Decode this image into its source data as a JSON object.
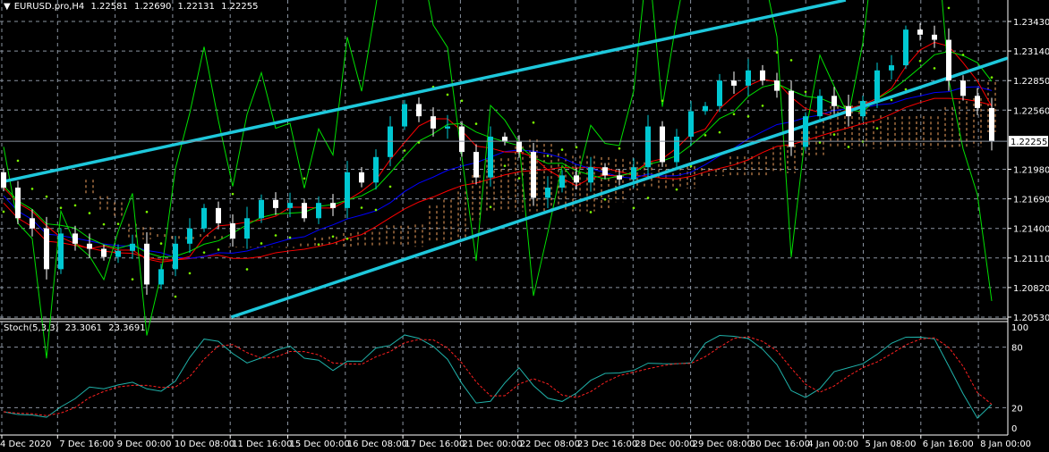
{
  "header": {
    "symbol": "EURUSD.pro,H4",
    "open": "1.22581",
    "high": "1.22690",
    "low": "1.22131",
    "close": "1.22255"
  },
  "stoch_header": {
    "name": "Stoch(5,3,3)",
    "main": "23.3061",
    "signal": "23.3691"
  },
  "colors": {
    "background": "#000000",
    "grid": "#8a93a0",
    "bull_candle": "#00c8d2",
    "bear_candle": "#ffffff",
    "trendline": "#1ec8dc",
    "ma_fast": "#ff0000",
    "ma_slow": "#0000ff",
    "ma_green": "#00e000",
    "cloud": "#f4a460",
    "sar": "#7cfc00",
    "stoch_main": "#20b2aa",
    "stoch_signal": "#ff2020"
  },
  "chart_data": [
    {
      "type": "candlestick",
      "title": "EURUSD.pro,H4",
      "price_ticks": [
        "1.23430",
        "1.23140",
        "1.22850",
        "1.22560",
        "1.21980",
        "1.21690",
        "1.21400",
        "1.21110",
        "1.20820",
        "1.20530"
      ],
      "current_price": "1.22255",
      "ylim": [
        1.2053,
        1.2343
      ],
      "time_labels": [
        "4 Dec 2020",
        "7 Dec 16:00",
        "9 Dec 00:00",
        "10 Dec 08:00",
        "11 Dec 16:00",
        "15 Dec 00:00",
        "16 Dec 08:00",
        "17 Dec 16:00",
        "21 Dec 00:00",
        "22 Dec 08:00",
        "23 Dec 16:00",
        "28 Dec 00:00",
        "29 Dec 08:00",
        "30 Dec 16:00",
        "4 Jan 00:00",
        "5 Jan 08:00",
        "6 Jan 16:00",
        "8 Jan 00:00"
      ],
      "closes": [
        1.218,
        1.215,
        1.214,
        1.21,
        1.2135,
        1.2125,
        1.212,
        1.2112,
        1.2118,
        1.2125,
        1.2085,
        1.21,
        1.2125,
        1.214,
        1.216,
        1.2145,
        1.213,
        1.215,
        1.2168,
        1.216,
        1.2165,
        1.215,
        1.2165,
        1.216,
        1.2195,
        1.2185,
        1.221,
        1.224,
        1.2262,
        1.225,
        1.2238,
        1.224,
        1.2215,
        1.219,
        1.223,
        1.2225,
        1.2215,
        1.217,
        1.218,
        1.2192,
        1.2185,
        1.22,
        1.2192,
        1.2188,
        1.22,
        1.224,
        1.2205,
        1.223,
        1.2255,
        1.226,
        1.2285,
        1.228,
        1.2295,
        1.2285,
        1.2275,
        1.222,
        1.225,
        1.227,
        1.226,
        1.225,
        1.2265,
        1.2295,
        1.23,
        1.2335,
        1.233,
        1.2325,
        1.2285,
        1.227,
        1.22581,
        1.22255
      ],
      "trendlines": [
        {
          "from_bar": 0,
          "from_price": 1.2186,
          "to_bar": 58.8,
          "to_price": 1.2364
        },
        {
          "from_bar": 15.9,
          "from_price": 1.2053,
          "to_bar": 70.1,
          "to_price": 1.2307
        }
      ],
      "indicators": [
        "moving averages",
        "ichimoku cloud",
        "parabolic sar"
      ]
    },
    {
      "type": "line",
      "title": "Stoch(5,3,3)",
      "y_ticks": [
        "100",
        "80",
        "20",
        "0"
      ],
      "ylim": [
        0,
        100
      ],
      "levels": [
        80,
        20
      ],
      "last_main": 23.3061,
      "last_signal": 23.3691
    }
  ]
}
